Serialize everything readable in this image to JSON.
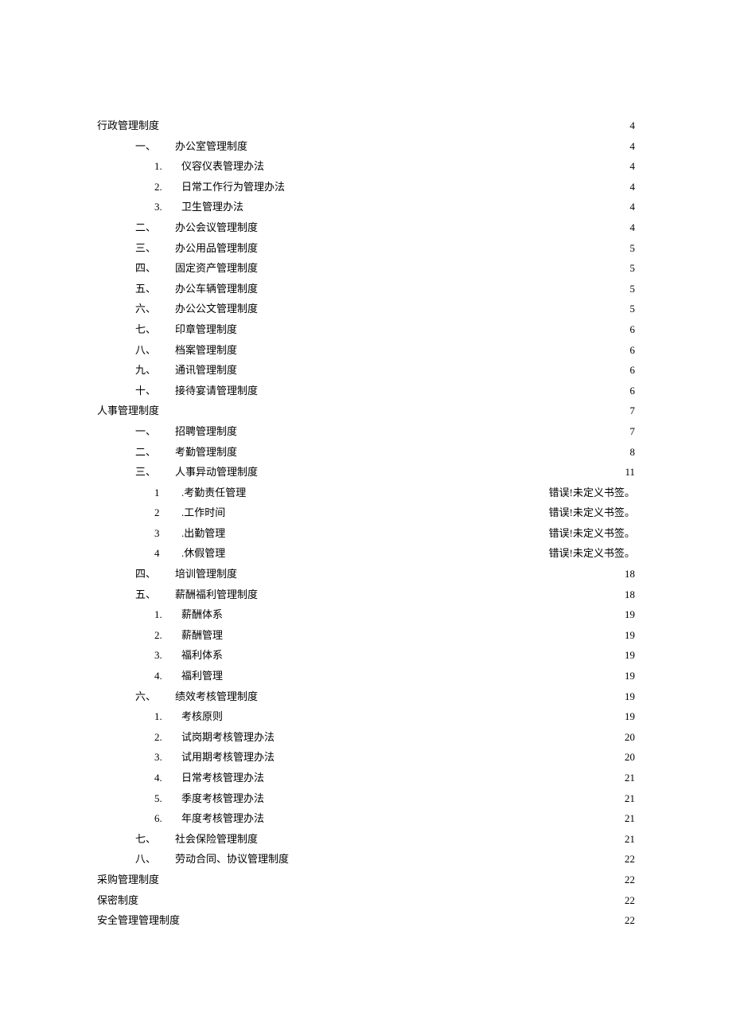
{
  "toc": [
    {
      "level": 0,
      "marker": "",
      "label": "行政管理制度",
      "page": "4"
    },
    {
      "level": 1,
      "marker": "一、",
      "label": "办公室管理制度",
      "page": "4"
    },
    {
      "level": 2,
      "marker": "1.",
      "label": "仪容仪表管理办法",
      "page": "4"
    },
    {
      "level": 2,
      "marker": "2.",
      "label": "日常工作行为管理办法",
      "page": "4"
    },
    {
      "level": 2,
      "marker": "3.",
      "label": "卫生管理办法",
      "page": "4"
    },
    {
      "level": 1,
      "marker": "二、",
      "label": "办公会议管理制度",
      "page": "4"
    },
    {
      "level": 1,
      "marker": "三、",
      "label": "办公用品管理制度",
      "page": "5"
    },
    {
      "level": 1,
      "marker": "四、",
      "label": "固定资产管理制度",
      "page": "5"
    },
    {
      "level": 1,
      "marker": "五、",
      "label": "办公车辆管理制度",
      "page": "5"
    },
    {
      "level": 1,
      "marker": "六、",
      "label": "办公公文管理制度",
      "page": "5"
    },
    {
      "level": 1,
      "marker": "七、",
      "label": "印章管理制度",
      "page": "6"
    },
    {
      "level": 1,
      "marker": "八、",
      "label": "档案管理制度",
      "page": "6"
    },
    {
      "level": 1,
      "marker": "九、",
      "label": "通讯管理制度",
      "page": "6"
    },
    {
      "level": 1,
      "marker": "十、",
      "label": "接待宴请管理制度",
      "page": "6"
    },
    {
      "level": 0,
      "marker": "",
      "label": "人事管理制度",
      "page": "7"
    },
    {
      "level": 1,
      "marker": "一、",
      "label": "招聘管理制度",
      "page": "7"
    },
    {
      "level": 1,
      "marker": "二、",
      "label": "考勤管理制度",
      "page": "8"
    },
    {
      "level": 1,
      "marker": "三、",
      "label": "人事异动管理制度",
      "page": "11"
    },
    {
      "level": 2,
      "marker": "1",
      "label": ".考勤责任管理",
      "page": "错误!未定义书签。",
      "err": true
    },
    {
      "level": 2,
      "marker": "2",
      "label": ".工作时间",
      "page": "错误!未定义书签。",
      "err": true
    },
    {
      "level": 2,
      "marker": "3",
      "label": ".出勤管理",
      "page": "错误!未定义书签。",
      "err": true
    },
    {
      "level": 2,
      "marker": "4",
      "label": ".休假管理",
      "page": "错误!未定义书签。",
      "err": true
    },
    {
      "level": 1,
      "marker": "四、",
      "label": "培训管理制度",
      "page": "18"
    },
    {
      "level": 1,
      "marker": "五、",
      "label": "薪酬福利管理制度",
      "page": "18"
    },
    {
      "level": 2,
      "marker": "1.",
      "label": "薪酬体系",
      "page": "19"
    },
    {
      "level": 2,
      "marker": "2.",
      "label": "薪酬管理",
      "page": "19"
    },
    {
      "level": 2,
      "marker": "3.",
      "label": "福利体系",
      "page": "19"
    },
    {
      "level": 2,
      "marker": "4.",
      "label": "福利管理",
      "page": "19"
    },
    {
      "level": 1,
      "marker": "六、",
      "label": "绩效考核管理制度",
      "page": "19"
    },
    {
      "level": 2,
      "marker": "1.",
      "label": "考核原则",
      "page": "19"
    },
    {
      "level": 2,
      "marker": "2.",
      "label": "试岗期考核管理办法",
      "page": "20"
    },
    {
      "level": 2,
      "marker": "3.",
      "label": "试用期考核管理办法",
      "page": "20"
    },
    {
      "level": 2,
      "marker": "4.",
      "label": "日常考核管理办法",
      "page": "21"
    },
    {
      "level": 2,
      "marker": "5.",
      "label": "季度考核管理办法",
      "page": "21"
    },
    {
      "level": 2,
      "marker": "6.",
      "label": "年度考核管理办法",
      "page": "21"
    },
    {
      "level": 1,
      "marker": "七、",
      "label": "社会保险管理制度",
      "page": "21"
    },
    {
      "level": 1,
      "marker": "八、",
      "label": "劳动合同、协议管理制度",
      "page": "22"
    },
    {
      "level": 0,
      "marker": "",
      "label": "采购管理制度",
      "page": "22"
    },
    {
      "level": 0,
      "marker": "",
      "label": "保密制度",
      "page": "22"
    },
    {
      "level": 0,
      "marker": "",
      "label": "安全管理管理制度",
      "page": "22"
    }
  ]
}
